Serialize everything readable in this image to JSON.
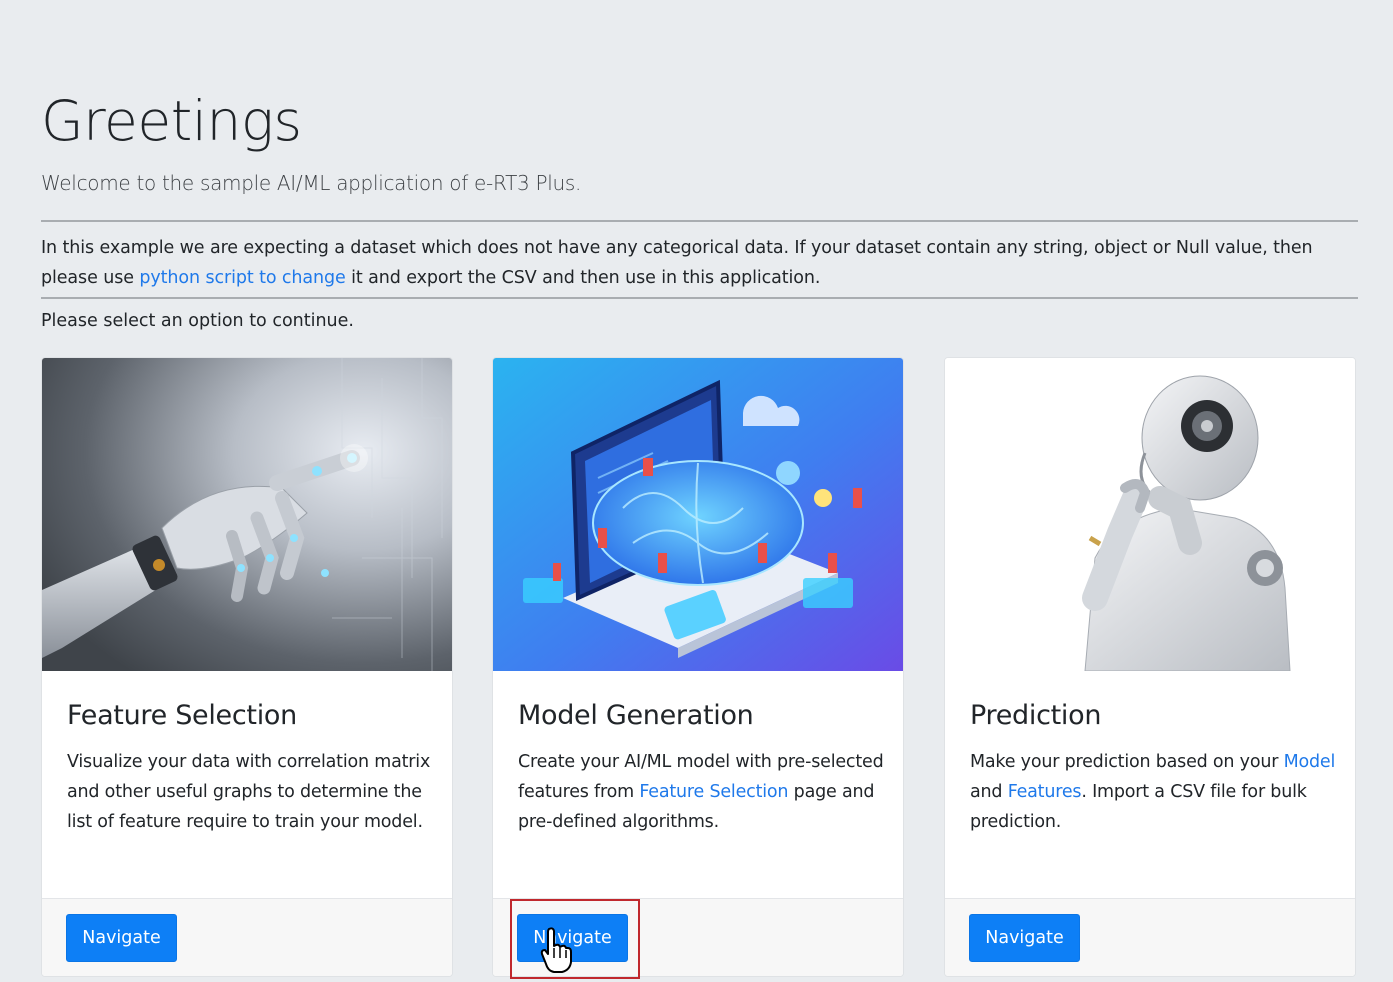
{
  "header": {
    "title": "Greetings",
    "lead": "Welcome to the sample AI/ML application of e-RT3 Plus."
  },
  "intro": {
    "text_before": "In this example we are expecting a dataset which does not have any categorical data. If your dataset contain any string, object or Null value, then please use ",
    "link_text": "python script to change",
    "text_after": " it and export the CSV and then use in this application."
  },
  "prompt": "Please select an option to continue.",
  "cards": [
    {
      "title": "Feature Selection",
      "text": "Visualize your data with correlation matrix and other useful graphs to determine the list of feature require to train your model.",
      "button": "Navigate",
      "image": "robot-hand-illustration"
    },
    {
      "title": "Model Generation",
      "text_before": "Create your AI/ML model with pre-selected features from ",
      "link": "Feature Selection",
      "text_after": " page and pre-defined algorithms.",
      "button": "Navigate",
      "image": "brain-laptop-illustration"
    },
    {
      "title": "Prediction",
      "text_before": "Make your prediction based on your ",
      "link1": "Model",
      "text_mid": " and ",
      "link2": "Features",
      "text_after": ". Import a CSV file for bulk prediction.",
      "button": "Navigate",
      "image": "thinking-robot-illustration"
    }
  ],
  "colors": {
    "page_bg": "#e9ecef",
    "primary": "#0d7ff6",
    "link": "#1f79ea",
    "highlight": "#c0282d"
  }
}
